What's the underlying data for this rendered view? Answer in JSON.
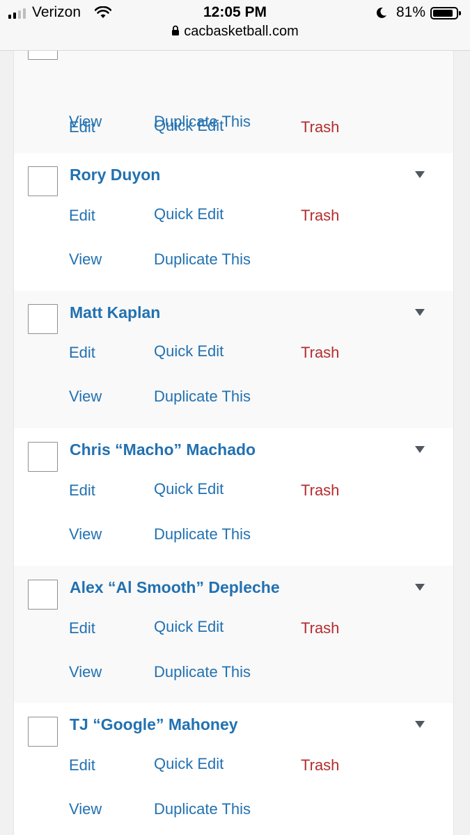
{
  "status_bar": {
    "carrier": "Verizon",
    "time": "12:05 PM",
    "battery_percent": "81%",
    "battery_level": 0.81,
    "url": "cacbasketball.com"
  },
  "actions": {
    "edit": "Edit",
    "quick_edit": "Quick Edit",
    "trash": "Trash",
    "view": "View",
    "duplicate": "Duplicate This"
  },
  "rows": [
    {
      "title": ""
    },
    {
      "title": "Rory Duyon"
    },
    {
      "title": "Matt Kaplan"
    },
    {
      "title": "Chris “Macho” Machado"
    },
    {
      "title": "Alex “Al Smooth” Depleche"
    },
    {
      "title": "TJ “Google” Mahoney"
    }
  ],
  "colors": {
    "link": "#2271b1",
    "trash": "#b32d2e",
    "row_alt_bg": "#f9f9f9"
  }
}
